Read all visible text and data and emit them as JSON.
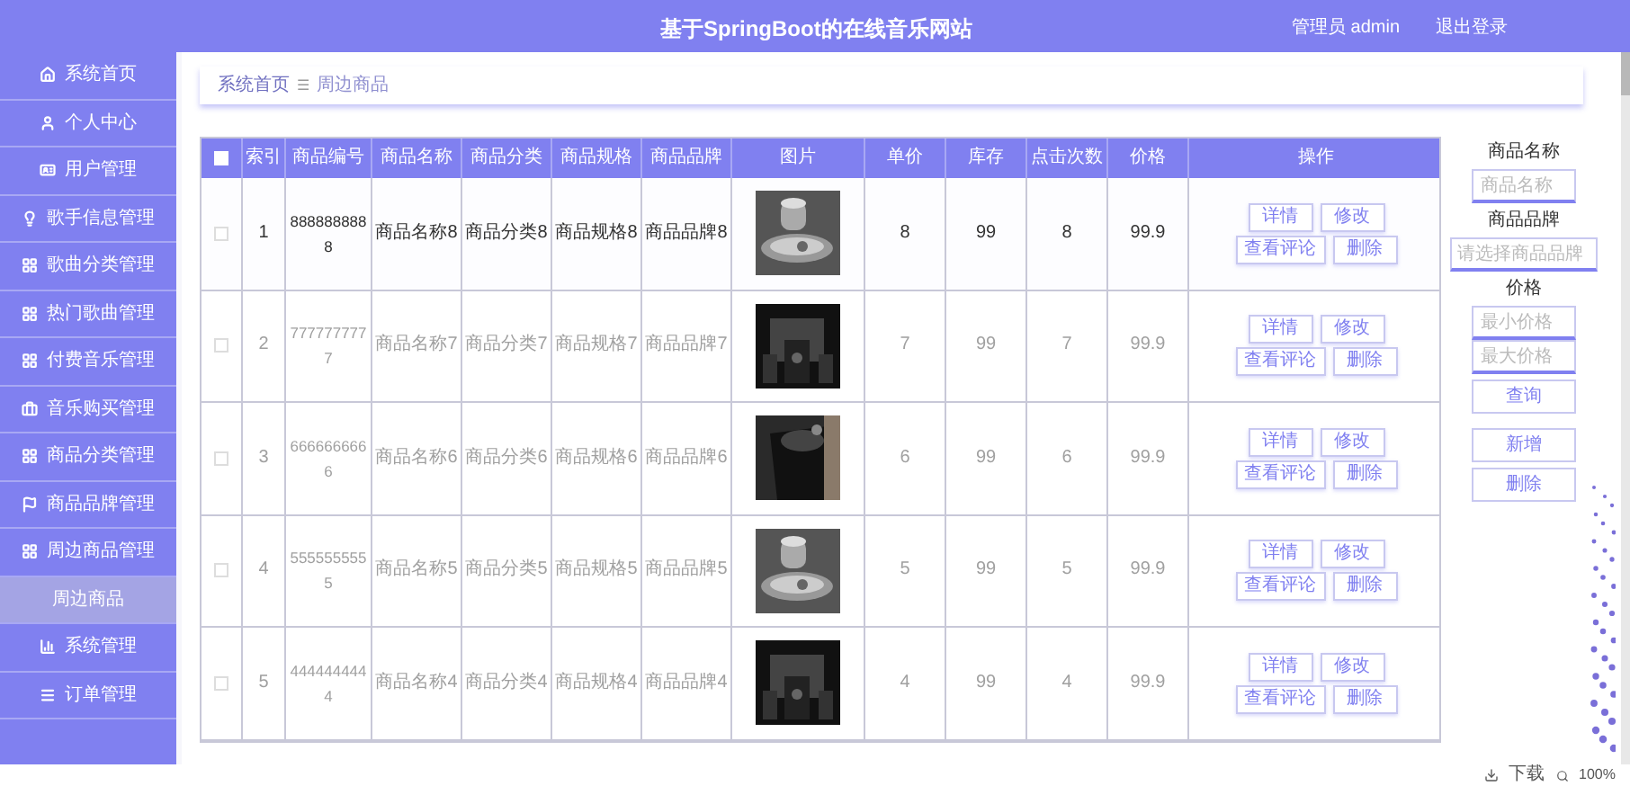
{
  "header": {
    "title": "基于SpringBoot的在线音乐网站",
    "user": "管理员 admin",
    "logout": "退出登录"
  },
  "sidebar": {
    "items": [
      {
        "label": "系统首页",
        "selected": false
      },
      {
        "label": "个人中心",
        "selected": false
      },
      {
        "label": "用户管理",
        "selected": false
      },
      {
        "label": "歌手信息管理",
        "selected": false
      },
      {
        "label": "歌曲分类管理",
        "selected": false
      },
      {
        "label": "热门歌曲管理",
        "selected": false
      },
      {
        "label": "付费音乐管理",
        "selected": false
      },
      {
        "label": "音乐购买管理",
        "selected": false
      },
      {
        "label": "商品分类管理",
        "selected": false
      },
      {
        "label": "商品品牌管理",
        "selected": false
      },
      {
        "label": "周边商品管理",
        "selected": false
      },
      {
        "label": "周边商品",
        "selected": true
      },
      {
        "label": "系统管理",
        "selected": false
      },
      {
        "label": "订单管理",
        "selected": false
      }
    ]
  },
  "breadcrumb": [
    "系统首页",
    "周边商品"
  ],
  "breadcrumb_separator": "☰",
  "table": {
    "select_all": {
      "checked": false
    },
    "columns": [
      "索引",
      "商品编号",
      "商品名称",
      "商品分类",
      "商品规格",
      "商品品牌",
      "图片",
      "单价",
      "库存",
      "点击次数",
      "价格",
      "操作"
    ],
    "rows": [
      {
        "checked": false,
        "hovered": true,
        "cells": [
          "1",
          "8888888888",
          "商品名称8",
          "商品分类8",
          "商品规格8",
          "商品品牌8",
          {
            "kind": "picture"
          },
          "8",
          "99",
          "8",
          "99.9"
        ],
        "actions": [
          "详情",
          "修改",
          "查看评论",
          "删除"
        ]
      },
      {
        "checked": false,
        "hovered": false,
        "cells": [
          "2",
          "7777777777",
          "商品名称7",
          "商品分类7",
          "商品规格7",
          "商品品牌7",
          {
            "kind": "picture"
          },
          "7",
          "99",
          "7",
          "99.9"
        ],
        "actions": [
          "详情",
          "修改",
          "查看评论",
          "删除"
        ]
      },
      {
        "checked": false,
        "hovered": false,
        "cells": [
          "3",
          "6666666666",
          "商品名称6",
          "商品分类6",
          "商品规格6",
          "商品品牌6",
          {
            "kind": "picture"
          },
          "6",
          "99",
          "6",
          "99.9"
        ],
        "actions": [
          "详情",
          "修改",
          "查看评论",
          "删除"
        ]
      },
      {
        "checked": false,
        "hovered": false,
        "cells": [
          "4",
          "5555555555",
          "商品名称5",
          "商品分类5",
          "商品规格5",
          "商品品牌5",
          {
            "kind": "picture"
          },
          "5",
          "99",
          "5",
          "99.9"
        ],
        "actions": [
          "详情",
          "修改",
          "查看评论",
          "删除"
        ]
      },
      {
        "checked": false,
        "hovered": false,
        "cells": [
          "5",
          "4444444444",
          "商品名称4",
          "商品分类4",
          "商品规格4",
          "商品品牌4",
          {
            "kind": "picture"
          },
          "4",
          "99",
          "4",
          "99.9"
        ],
        "actions": [
          "详情",
          "修改",
          "查看评论",
          "删除"
        ]
      }
    ]
  },
  "filters": {
    "name_label": "商品名称",
    "name_placeholder": "商品名称",
    "brand_label": "商品品牌",
    "brand_placeholder": "请选择商品品牌",
    "price_label": "价格",
    "min_placeholder": "最小价格",
    "max_placeholder": "最大价格",
    "search_button": "查询",
    "add_button": "新增",
    "delete_button": "删除"
  },
  "status_bar": {
    "download": "下载",
    "zoom": "100%"
  }
}
